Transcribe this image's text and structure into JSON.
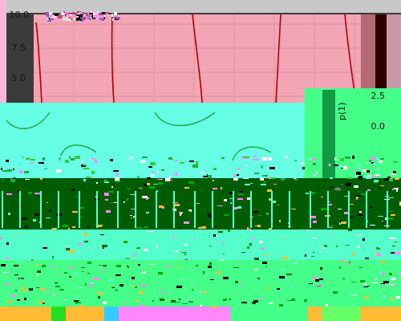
{
  "labels": {
    "y_top_1": "10.0",
    "y_top_2": "7.5",
    "y_top_3": "5.0",
    "y_mid_1": "2.5",
    "y_mid_2": "0.0",
    "y_label_partial": "p(1)"
  },
  "colors": {
    "top_bg": "#f2a6b5",
    "top_grid": "#d68c9b",
    "top_curve": "#b30000",
    "top_panel_right": "#b56a73",
    "top_panel_dark": "#300000",
    "mid_bg": "#66ffe6",
    "mid_curve": "#22aa44",
    "mid_right_bg": "#44ff88",
    "bottom_dark": "#005c00",
    "bottom_light": "#55ffcc",
    "bottom_strip_1": "#ffbb33",
    "bottom_strip_2": "#ff88ff",
    "bottom_strip_3": "#cc66cc",
    "noise_1": "#1a1a1a",
    "noise_2": "#ffffff",
    "noise_3": "#000000"
  }
}
